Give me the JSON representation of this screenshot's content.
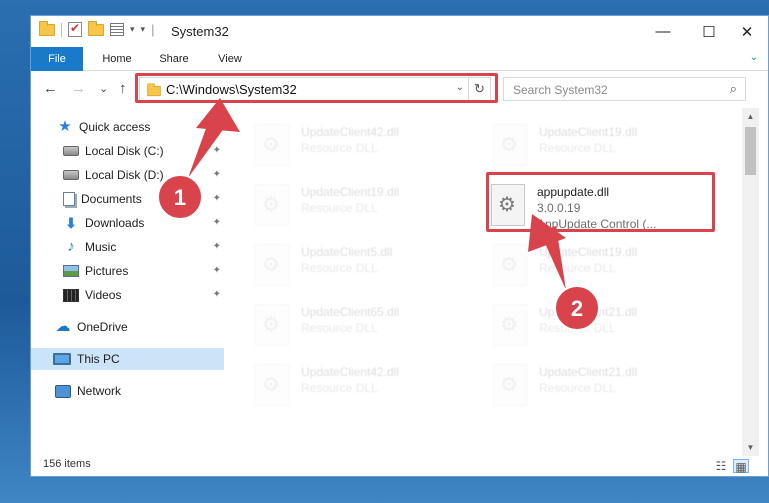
{
  "window": {
    "title": "System32",
    "minimize": "—",
    "maximize": "☐",
    "close": "✕"
  },
  "qat": {
    "dropdown": "▾",
    "pipe": "|"
  },
  "ribbon": {
    "tabs": [
      "File",
      "Home",
      "Share",
      "View"
    ],
    "expand": "⌄"
  },
  "nav": {
    "back": "←",
    "forward": "→",
    "recent": "⌄",
    "up": "↑",
    "address": "C:\\Windows\\System32",
    "address_dropdown": "⌄",
    "refresh": "↻",
    "search_placeholder": "Search System32",
    "search_icon": "⌕"
  },
  "sidebar": {
    "items": [
      {
        "label": "Quick access",
        "icon": "star-icon"
      },
      {
        "label": "Local Disk (C:)",
        "icon": "disk-icon",
        "pinned": true
      },
      {
        "label": "Local Disk (D:)",
        "icon": "disk-icon",
        "pinned": true
      },
      {
        "label": "Documents",
        "icon": "documents-icon",
        "pinned": true
      },
      {
        "label": "Downloads",
        "icon": "downloads-icon",
        "pinned": true
      },
      {
        "label": "Music",
        "icon": "music-icon",
        "pinned": true
      },
      {
        "label": "Pictures",
        "icon": "pictures-icon",
        "pinned": true
      },
      {
        "label": "Videos",
        "icon": "videos-icon",
        "pinned": true
      },
      {
        "label": "OneDrive",
        "icon": "onedrive-icon"
      },
      {
        "label": "This PC",
        "icon": "this-pc-icon",
        "selected": true
      },
      {
        "label": "Network",
        "icon": "network-icon"
      }
    ],
    "pin_glyph": "📌"
  },
  "files": {
    "left_column": [
      {
        "name": "UpdateClient42.dll",
        "type": "Resource DLL"
      },
      {
        "name": "UpdateClient19.dll",
        "type": "Resource DLL"
      },
      {
        "name": "UpdateClient5.dll",
        "type": "Resource DLL"
      },
      {
        "name": "UpdateClient65.dll",
        "type": "Resource DLL"
      },
      {
        "name": "UpdateClient42.dll",
        "type": "Resource DLL"
      }
    ],
    "right_column": [
      {
        "name": "UpdateClient19.dll",
        "type": "Resource DLL"
      },
      {
        "name": "UpdateClient19.dll",
        "type": "Resource DLL"
      },
      {
        "name": "UpdateClient21.dll",
        "type": "Resource DLL"
      },
      {
        "name": "UpdateClient21.dll",
        "type": "Resource DLL"
      }
    ],
    "highlighted": {
      "name": "appupdate.dll",
      "version": "3.0.0.19",
      "description": "AppUpdate Control (..."
    }
  },
  "status": {
    "item_count": "156 items"
  },
  "annotations": {
    "step1": "1",
    "step2": "2",
    "color": "#d9434b"
  }
}
